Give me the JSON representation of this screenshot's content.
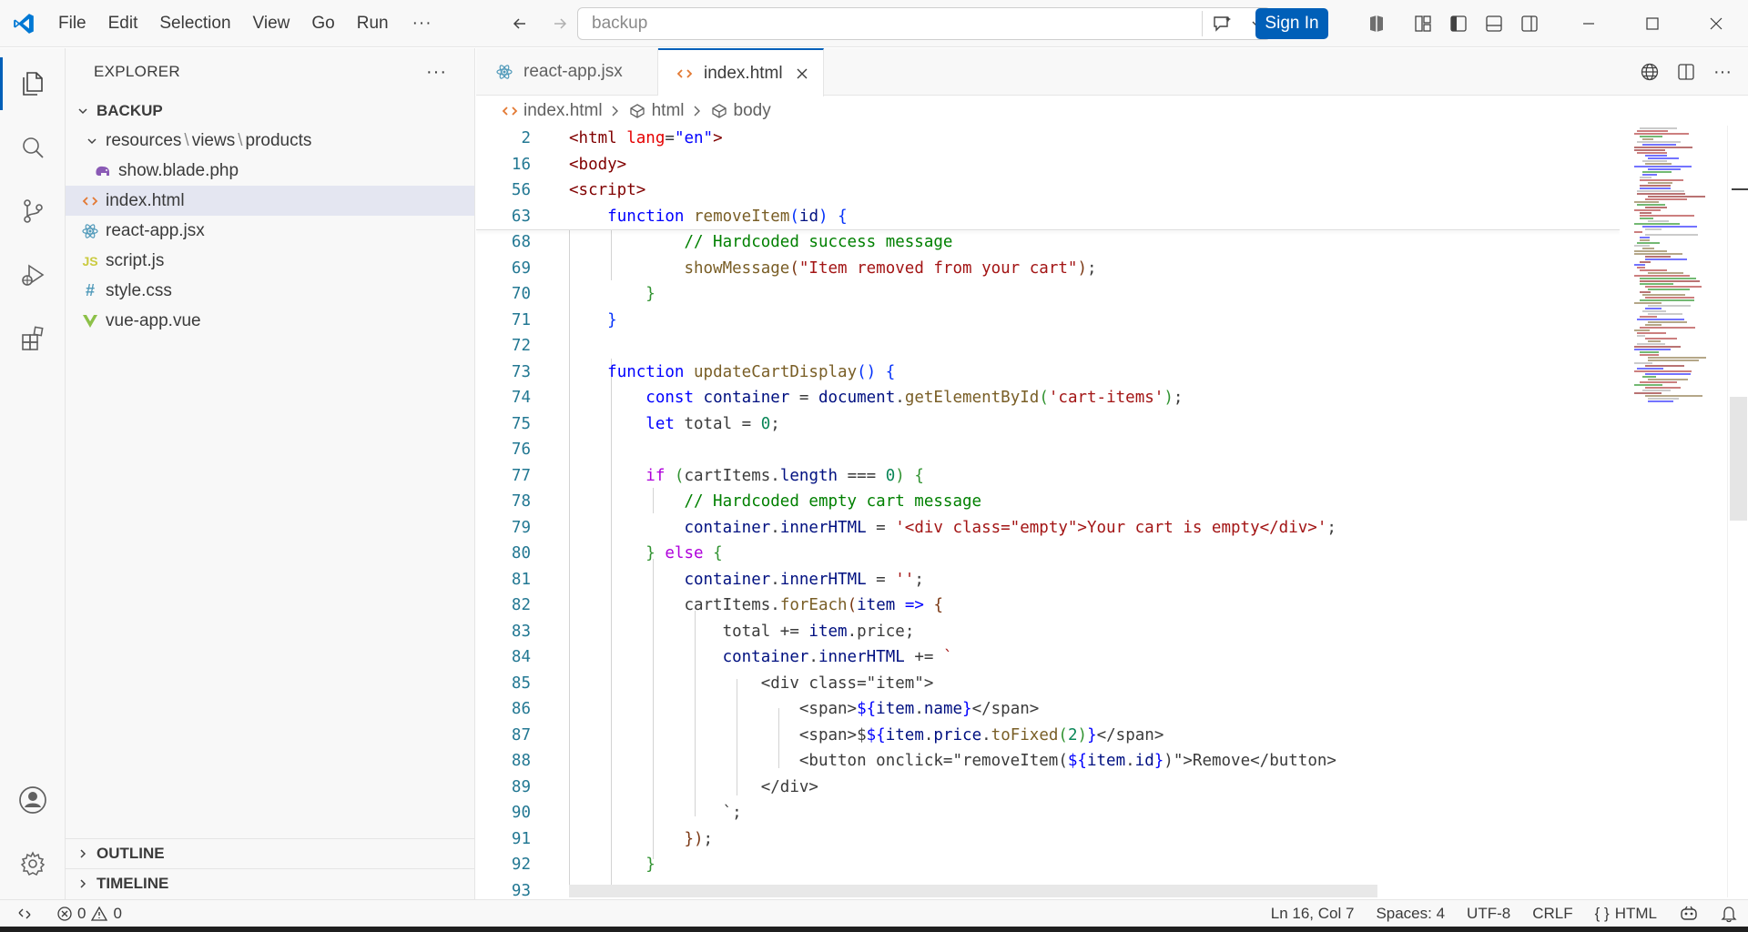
{
  "titlebar": {
    "menu": [
      "File",
      "Edit",
      "Selection",
      "View",
      "Go",
      "Run"
    ],
    "more": "···",
    "search_text": "backup",
    "sign_in": "Sign In"
  },
  "explorer": {
    "title": "EXPLORER",
    "more": "···",
    "root": "BACKUP",
    "folder_path": [
      "resources",
      "views",
      "products"
    ],
    "files": [
      {
        "name": "show.blade.php",
        "icon": "php-elephant-icon"
      },
      {
        "name": "index.html",
        "icon": "html-brackets-icon"
      },
      {
        "name": "react-app.jsx",
        "icon": "react-atom-icon"
      },
      {
        "name": "script.js",
        "icon": "js-icon"
      },
      {
        "name": "style.css",
        "icon": "css-hash-icon"
      },
      {
        "name": "vue-app.vue",
        "icon": "vue-icon"
      }
    ],
    "outline": "OUTLINE",
    "timeline": "TIMELINE"
  },
  "tabs": [
    {
      "label": "react-app.jsx",
      "active": false
    },
    {
      "label": "index.html",
      "active": true
    }
  ],
  "breadcrumb": [
    "index.html",
    "html",
    "body"
  ],
  "sticky_lines": [
    {
      "n": "2",
      "html": "<span class='t-tag'>&lt;html</span> <span class='t-attr'>lang</span><span class='t-sym'>=</span><span class='t-str'>\"en\"</span><span class='t-tag'>&gt;</span>"
    },
    {
      "n": "16",
      "html": "<span class='t-tag'>&lt;body&gt;</span>"
    },
    {
      "n": "56",
      "html": "<span class='t-tag'>&lt;script&gt;</span>"
    },
    {
      "n": "63",
      "html": "    <span class='t-kw'>function</span> <span class='t-fn'>removeItem</span><span class='t-b1'>(</span><span class='t-var'>id</span><span class='t-b1'>)</span> <span class='t-b1'>{</span>"
    }
  ],
  "code_lines": [
    {
      "n": "68",
      "html": "            <span class='t-cmt'>// Hardcoded success message</span>"
    },
    {
      "n": "69",
      "html": "            <span class='t-fn'>showMessage</span><span class='t-b3'>(</span><span class='t-tstr'>\"Item removed from your cart\"</span><span class='t-b3'>)</span>;"
    },
    {
      "n": "70",
      "html": "        <span class='t-b2'>}</span>"
    },
    {
      "n": "71",
      "html": "    <span class='t-b1'>}</span>"
    },
    {
      "n": "72",
      "html": ""
    },
    {
      "n": "73",
      "html": "    <span class='t-kw'>function</span> <span class='t-fn'>updateCartDisplay</span><span class='t-b1'>()</span> <span class='t-b1'>{</span>"
    },
    {
      "n": "74",
      "html": "        <span class='t-kw'>const</span> <span class='t-var'>container</span> = <span class='t-var'>document</span>.<span class='t-fn'>getElementById</span><span class='t-b2'>(</span><span class='t-tstr'>'cart-items'</span><span class='t-b2'>)</span>;"
    },
    {
      "n": "75",
      "html": "        <span class='t-kw'>let</span> <span class='t-sym'>total</span> = <span class='t-num'>0</span>;"
    },
    {
      "n": "76",
      "html": ""
    },
    {
      "n": "77",
      "html": "        <span class='t-ctl'>if</span> <span class='t-b2'>(</span><span class='t-sym'>cartItems</span>.<span class='t-var'>length</span> === <span class='t-num'>0</span><span class='t-b2'>)</span> <span class='t-b2'>{</span>"
    },
    {
      "n": "78",
      "html": "            <span class='t-cmt'>// Hardcoded empty cart message</span>"
    },
    {
      "n": "79",
      "html": "            <span class='t-var'>container</span>.<span class='t-var'>innerHTML</span> = <span class='t-tstr'>'&lt;div class=\"empty\"&gt;Your cart is empty&lt;/div&gt;'</span>;"
    },
    {
      "n": "80",
      "html": "        <span class='t-b2'>}</span> <span class='t-ctl'>else</span> <span class='t-b2'>{</span>"
    },
    {
      "n": "81",
      "html": "            <span class='t-var'>container</span>.<span class='t-var'>innerHTML</span> = <span class='t-tstr'>''</span>;"
    },
    {
      "n": "82",
      "html": "            <span class='t-sym'>cartItems</span>.<span class='t-fn'>forEach</span><span class='t-b3'>(</span><span class='t-var'>item</span> <span class='t-kw'>=&gt;</span> <span class='t-b3'>{</span>"
    },
    {
      "n": "83",
      "html": "                <span class='t-sym'>total</span> += <span class='t-var'>item</span>.<span class='t-sym'>price</span>;"
    },
    {
      "n": "84",
      "html": "                <span class='t-var'>container</span>.<span class='t-var'>innerHTML</span> += <span class='t-tstr'>`</span>"
    },
    {
      "n": "85",
      "html": "                    <span class='t-sym'>&lt;div class=\"item\"&gt;</span>"
    },
    {
      "n": "86",
      "html": "                        <span class='t-sym'>&lt;span&gt;</span><span class='t-kw'>${</span><span class='t-var'>item</span>.<span class='t-var'>name</span><span class='t-kw'>}</span><span class='t-sym'>&lt;/span&gt;</span>"
    },
    {
      "n": "87",
      "html": "                        <span class='t-sym'>&lt;span&gt;$</span><span class='t-kw'>${</span><span class='t-var'>item</span>.<span class='t-var'>price</span>.<span class='t-fn'>toFixed</span><span class='t-b2'>(</span><span class='t-num'>2</span><span class='t-b2'>)</span><span class='t-kw'>}</span><span class='t-sym'>&lt;/span&gt;</span>"
    },
    {
      "n": "88",
      "html": "                        <span class='t-sym'>&lt;button onclick=\"removeItem(</span><span class='t-kw'>${</span><span class='t-var'>item</span>.<span class='t-var'>id</span><span class='t-kw'>}</span><span class='t-sym'>)\"&gt;Remove&lt;/button&gt;</span>"
    },
    {
      "n": "89",
      "html": "                    <span class='t-sym'>&lt;/div&gt;</span>"
    },
    {
      "n": "90",
      "html": "                <span class='t-sym'>`</span>;"
    },
    {
      "n": "91",
      "html": "            <span class='t-b3'>}</span><span class='t-b3'>)</span>;"
    },
    {
      "n": "92",
      "html": "        <span class='t-b2'>}</span>"
    },
    {
      "n": "93",
      "html": ""
    }
  ],
  "statusbar": {
    "errors": "0",
    "warnings": "0",
    "position": "Ln 16, Col 7",
    "spaces": "Spaces: 4",
    "encoding": "UTF-8",
    "eol": "CRLF",
    "language": "HTML",
    "language_icon": "{ }"
  },
  "colors": {
    "accent": "#005fb8",
    "selection": "#e4e6f1",
    "chrome": "#f8f8f8"
  }
}
